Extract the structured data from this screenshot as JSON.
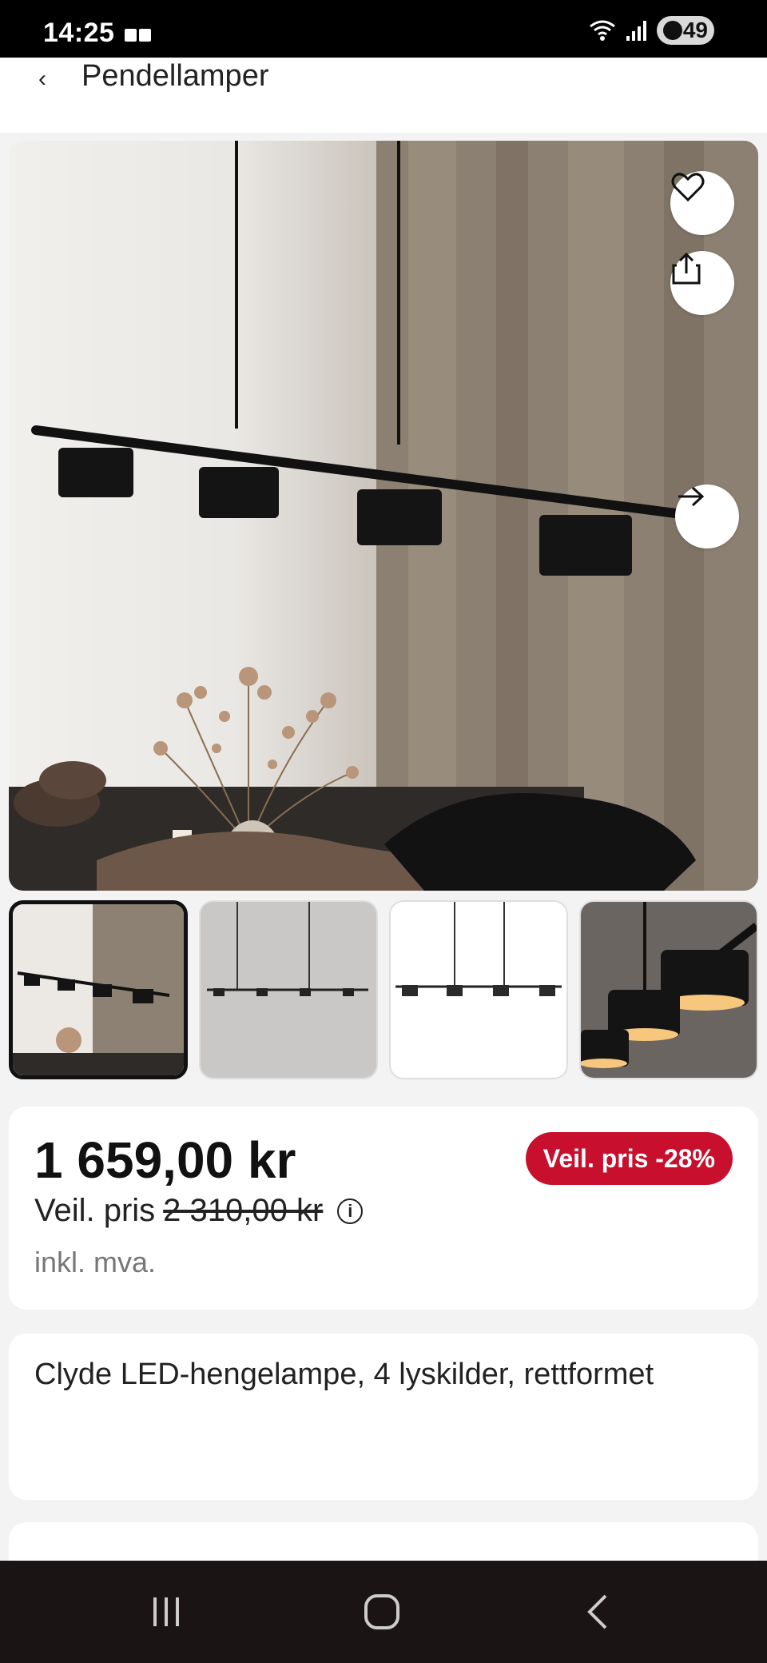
{
  "status_bar": {
    "time": "14:25",
    "battery": "49"
  },
  "header": {
    "back_icon": "chevron-left-icon",
    "title": "Pendellamper"
  },
  "gallery": {
    "favorite_icon": "heart-icon",
    "share_icon": "share-icon",
    "next_icon": "arrow-right-icon",
    "thumbnails": [
      {
        "name": "lamp-room-photo",
        "selected": true
      },
      {
        "name": "lamp-concrete-wall",
        "selected": false
      },
      {
        "name": "lamp-white-background",
        "selected": false
      },
      {
        "name": "lamp-closeup-lit",
        "selected": false
      }
    ]
  },
  "pricing": {
    "price": "1 659,00 kr",
    "old_price_label": "Veil. pris",
    "old_price": "2 310,00 kr",
    "info_icon": "info-icon",
    "vat_note": "inkl. mva.",
    "discount_badge": "Veil. pris -28%",
    "badge_color": "#c8102e"
  },
  "product": {
    "name": "Clyde LED-hengelampe, 4 lyskilder, rettformet"
  },
  "nav_bar": {
    "recents_icon": "recents-icon",
    "home_icon": "home-icon",
    "back_icon": "back-icon"
  }
}
